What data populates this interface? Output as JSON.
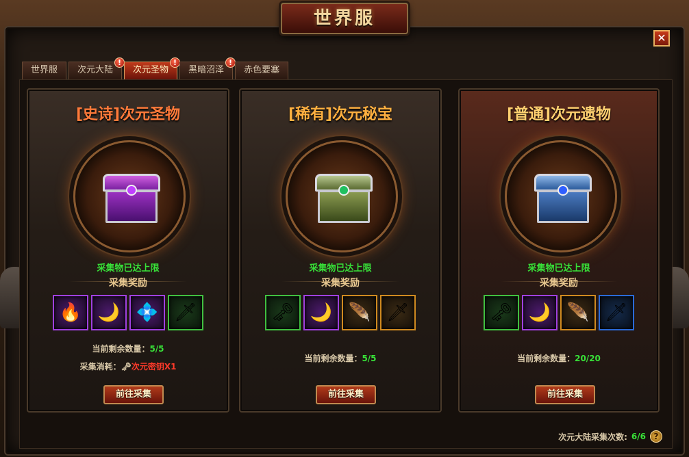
{
  "window": {
    "title": "世界服",
    "close": "✕"
  },
  "tabs": [
    {
      "label": "世界服",
      "alert": ""
    },
    {
      "label": "次元大陆",
      "alert": "!"
    },
    {
      "label": "次元圣物",
      "alert": "!"
    },
    {
      "label": "黑暗沼泽",
      "alert": "!"
    },
    {
      "label": "赤色要塞",
      "alert": ""
    }
  ],
  "active_tab": "次元圣物",
  "colors": {
    "epic": "#ff7a3a",
    "rare": "#ffb040",
    "common": "#ffd070",
    "status_green": "#38e038",
    "cost_red": "#ff3a2a"
  },
  "cards": [
    {
      "title": "[史诗]次元圣物",
      "status": "采集物已达上限",
      "reward_label": "采集奖励",
      "rewards": [
        {
          "icon": "fire-orb-icon",
          "glyph": "🔥"
        },
        {
          "icon": "moon-shard-icon",
          "glyph": "🌙"
        },
        {
          "icon": "rune-stone-icon",
          "glyph": "💠"
        },
        {
          "icon": "scimitar-icon",
          "glyph": "🗡"
        }
      ],
      "remain_label": "当前剩余数量：",
      "remain_value": "5/5",
      "cost_label": "采集消耗：",
      "cost_icon": "key-icon",
      "cost_value": "次元密钥X1",
      "button": "前往采集"
    },
    {
      "title": "[稀有]次元秘宝",
      "status": "采集物已达上限",
      "reward_label": "采集奖励",
      "rewards": [
        {
          "icon": "key-icon",
          "glyph": "🗝"
        },
        {
          "icon": "moon-shard-icon",
          "glyph": "🌙"
        },
        {
          "icon": "feather-icon",
          "glyph": "🪶"
        },
        {
          "icon": "dagger-icon",
          "glyph": "🗡"
        }
      ],
      "remain_label": "当前剩余数量：",
      "remain_value": "5/5",
      "button": "前往采集"
    },
    {
      "title": "[普通]次元遗物",
      "status": "采集物已达上限",
      "reward_label": "采集奖励",
      "rewards": [
        {
          "icon": "key-icon",
          "glyph": "🗝"
        },
        {
          "icon": "moon-shard-icon",
          "glyph": "🌙"
        },
        {
          "icon": "feather-icon",
          "glyph": "🪶"
        },
        {
          "icon": "sword-icon",
          "glyph": "🗡"
        }
      ],
      "remain_label": "当前剩余数量：",
      "remain_value": "20/20",
      "button": "前往采集"
    }
  ],
  "footer": {
    "label": "次元大陆采集次数:",
    "value": "6/6",
    "help": "?"
  }
}
